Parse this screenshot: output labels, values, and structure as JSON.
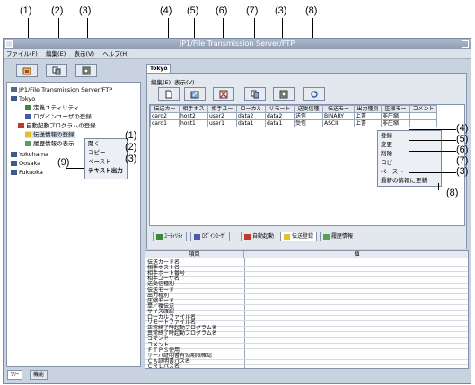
{
  "callouts_top": [
    "(1)",
    "(2)",
    "(3)",
    "(4)",
    "(5)",
    "(6)",
    "(7)",
    "(3)",
    "(8)"
  ],
  "callouts_left": [
    "(1)",
    "(2)",
    "(3)",
    "(9)"
  ],
  "callouts_right": [
    "(4)",
    "(5)",
    "(6)",
    "(7)",
    "(3)",
    "(8)"
  ],
  "window": {
    "title": "JP1/File Transmission Server/FTP"
  },
  "menu": [
    "ファイル(F)",
    "編集(E)",
    "表示(V)",
    "ヘルプ(H)"
  ],
  "tree": {
    "root": "JP1/File Transmission Server/FTP",
    "tokyo": "Tokyo",
    "children": [
      "定義ユティリティ",
      "ログインユーザの登録",
      "自動起動プログラムの登録",
      "伝送情報の登録",
      "履歴情報の表示"
    ],
    "others": [
      "Yokohama",
      "Oosaka",
      "Fukuoka"
    ]
  },
  "left_context_menu": [
    "開く",
    "コピー",
    "ペースト",
    "テキスト出力"
  ],
  "left_tabs": [
    "ﾂﾘｰ",
    "機能"
  ],
  "right": {
    "tab": "Tokyo",
    "menu": [
      "編集(E)",
      "表示(V)"
    ],
    "columns": [
      "伝送カー",
      "相手ホス",
      "相手ユー",
      "ローカル",
      "リモート",
      "送受信種",
      "伝送モー",
      "出力種別",
      "圧縮モー",
      "コメント"
    ],
    "rows": [
      [
        "card2",
        "host2",
        "user2",
        "data2",
        "data2",
        "送信",
        "BINARY",
        "上書",
        "非圧縮",
        ""
      ],
      [
        "card1",
        "host1",
        "user1",
        "data1",
        "data1",
        "受信",
        "ASCII",
        "上書",
        "非圧縮",
        ""
      ]
    ],
    "context_menu": [
      "登録",
      "変更",
      "削除",
      "コピー",
      "ペースト",
      "最新の情報に更新"
    ],
    "bottom_tabs": [
      "ﾕｰﾃｨﾘﾃｨ",
      "ﾛｸﾞｲﾝﾕｰｻﾞ",
      "自動起動",
      "伝送登録",
      "履歴情報"
    ],
    "prop_headers": [
      "項目",
      "値"
    ],
    "prop_items": [
      "伝送カード名",
      "相手ホスト名",
      "相手ポート番号",
      "相手ユーザ名",
      "送受信種別",
      "伝送モード",
      "出力種別",
      "圧縮モード",
      "単／複伝送",
      "サイズ確認",
      "ローカルファイル名",
      "リモートファイル名",
      "正常終了時起動プログラム名",
      "異常終了時起動プログラム名",
      "コマンド",
      "コメント",
      "ＦＴＰＳ使用",
      "サーバ証明書有効期限確認",
      "ＣＡ証明書パス名",
      "ＣＲＬパス名"
    ]
  },
  "colors": {
    "accent_red": "#c0392b",
    "accent_green": "#3a8a3a",
    "accent_yellow": "#e1c12a",
    "selection": "#2f5fb0"
  }
}
